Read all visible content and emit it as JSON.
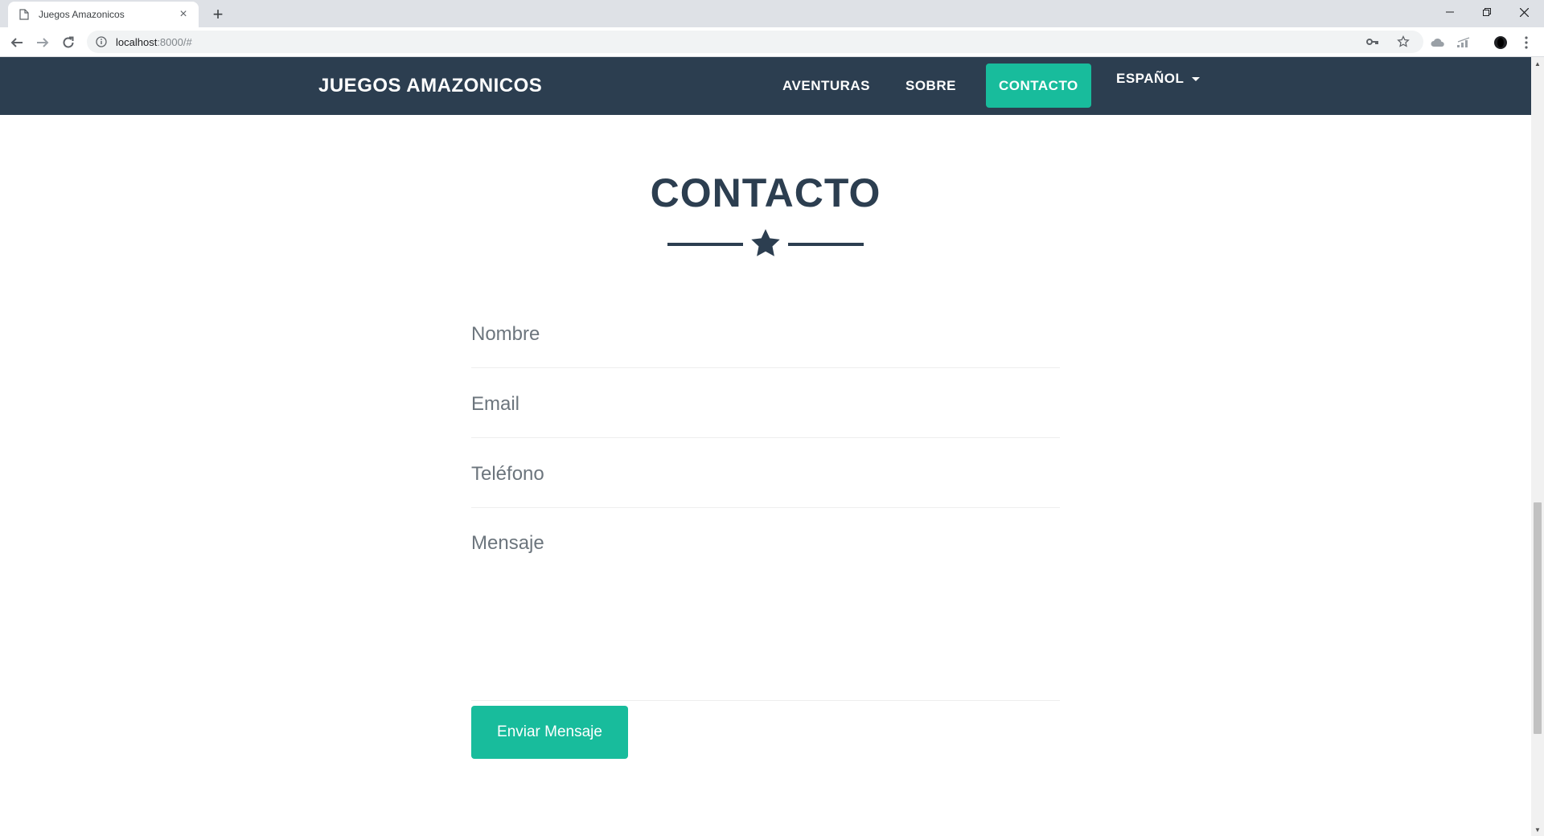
{
  "browser": {
    "tab_title": "Juegos Amazonicos",
    "url_host": "localhost",
    "url_rest": ":8000/#"
  },
  "site": {
    "brand": "JUEGOS AMAZONICOS",
    "nav": {
      "aventuras": "AVENTURAS",
      "sobre": "SOBRE",
      "contacto": "CONTACTO",
      "language": "ESPAÑOL"
    },
    "colors": {
      "navbar": "#2c3e50",
      "accent": "#18bc9c"
    }
  },
  "contact": {
    "title": "CONTACTO",
    "fields": {
      "name_placeholder": "Nombre",
      "email_placeholder": "Email",
      "phone_placeholder": "Teléfono",
      "message_placeholder": "Mensaje"
    },
    "submit_label": "Enviar Mensaje"
  }
}
